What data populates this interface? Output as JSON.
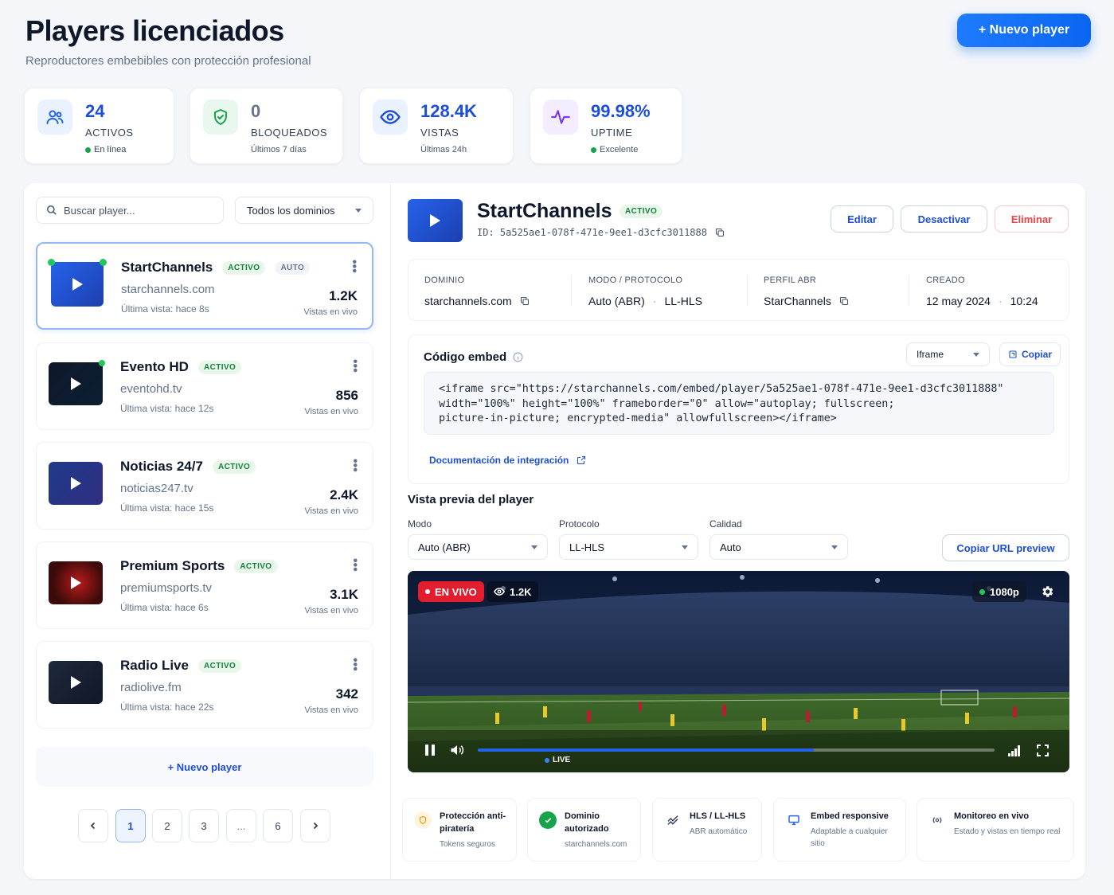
{
  "header": {
    "title": "Players licenciados",
    "subtitle": "Reproductores embebibles con protección profesional",
    "new_button": "+ Nuevo player"
  },
  "stats": [
    {
      "value": "24",
      "label": "ACTIVOS",
      "sub": "En línea",
      "icon": "users-icon"
    },
    {
      "value": "0",
      "label": "BLOQUEADOS",
      "sub": "Últimos 7 días",
      "icon": "shield-icon"
    },
    {
      "value": "128.4K",
      "label": "VISTAS",
      "sub": "Últimas 24h",
      "icon": "eye-icon"
    },
    {
      "value": "99.98%",
      "label": "UPTIME",
      "sub": "Excelente",
      "icon": "activity-icon"
    }
  ],
  "filters": {
    "search_placeholder": "Buscar player...",
    "domain_select": "Todos los dominios"
  },
  "players": [
    {
      "name": "StartChannels",
      "badge": "ACTIVO",
      "badge2": "AUTO",
      "domain": "starchannels.com",
      "last": "Última vista: hace 8s",
      "count": "1.2K",
      "count_label": "Vistas en vivo"
    },
    {
      "name": "Evento HD",
      "badge": "ACTIVO",
      "domain": "eventohd.tv",
      "last": "Última vista: hace 12s",
      "count": "856",
      "count_label": "Vistas en vivo"
    },
    {
      "name": "Noticias 24/7",
      "badge": "ACTIVO",
      "domain": "noticias247.tv",
      "last": "Última vista: hace 15s",
      "count": "2.4K",
      "count_label": "Vistas en vivo"
    },
    {
      "name": "Premium Sports",
      "badge": "ACTIVO",
      "domain": "premiumsports.tv",
      "last": "Última vista: hace 6s",
      "count": "3.1K",
      "count_label": "Vistas en vivo"
    },
    {
      "name": "Radio Live",
      "badge": "ACTIVO",
      "domain": "radiolive.fm",
      "last": "Última vista: hace 22s",
      "count": "342",
      "count_label": "Vistas en vivo"
    }
  ],
  "list_footer": {
    "add": "+ Nuevo player"
  },
  "pagination": [
    "1",
    "2",
    "3",
    "...",
    "6"
  ],
  "detail": {
    "name": "StartChannels",
    "badge": "ACTIVO",
    "id": "ID: 5a525ae1-078f-471e-9ee1-d3cfc3011888",
    "edit": "Editar",
    "deactivate": "Desactivar",
    "delete": "Eliminar",
    "info": {
      "domain_h": "DOMINIO",
      "domain_v": "starchannels.com",
      "mode_h": "MODO / PROTOCOLO",
      "mode_v": "Auto (ABR)",
      "mode_v2": "LL-HLS",
      "abr_h": "PERFIL ABR",
      "abr_v": "StarChannels",
      "created_h": "CREADO",
      "created_v": "12 may 2024",
      "created_t": "10:24"
    },
    "embed": {
      "title": "Código embed",
      "type": "Iframe",
      "copy": "Copiar",
      "code": "<iframe src=\"https://starchannels.com/embed/player/5a525ae1-078f-471e-9ee1-d3cfc3011888\"\nwidth=\"100%\" height=\"100%\" frameborder=\"0\" allow=\"autoplay; fullscreen;\npicture-in-picture; encrypted-media\" allowfullscreen></iframe>",
      "docs": "Documentación de integración"
    },
    "preview": {
      "title": "Vista previa del player",
      "mode_label": "Modo",
      "mode": "Auto (ABR)",
      "proto_label": "Protocolo",
      "proto": "LL-HLS",
      "quality_label": "Calidad",
      "quality": "Auto",
      "copy_url": "Copiar URL preview",
      "live": "EN VIVO",
      "viewers": "1.2K",
      "resolution": "1080p",
      "live_label": "LIVE",
      "progress": 0.65
    }
  },
  "features": [
    {
      "title": "Protección anti-piratería",
      "sub": "Tokens seguros",
      "icon": "shield-icon",
      "color": "#f59e0b"
    },
    {
      "title": "Dominio autorizado",
      "sub": "starchannels.com",
      "icon": "check-icon",
      "color": "#16a34a"
    },
    {
      "title": "HLS / LL-HLS",
      "sub": "ABR automático",
      "icon": "signal-icon",
      "color": "#334155"
    },
    {
      "title": "Embed responsive",
      "sub": "Adaptable a cualquier sitio",
      "icon": "monitor-icon",
      "color": "#2563eb"
    },
    {
      "title": "Monitoreo en vivo",
      "sub": "Estado y vistas en tiempo real",
      "icon": "broadcast-icon",
      "color": "#475569"
    }
  ]
}
